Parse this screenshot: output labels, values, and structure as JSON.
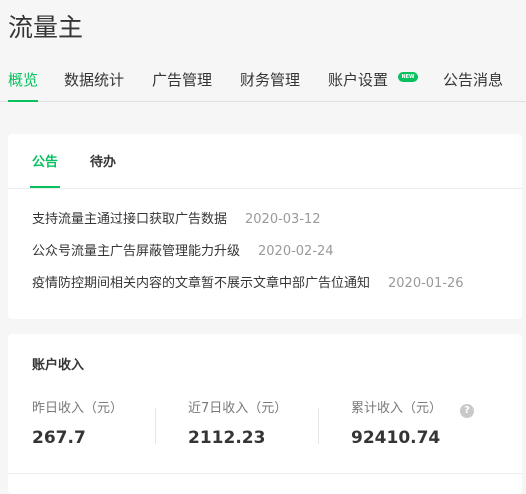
{
  "header": {
    "title": "流量主"
  },
  "nav": {
    "tabs": [
      {
        "label": "概览"
      },
      {
        "label": "数据统计"
      },
      {
        "label": "广告管理"
      },
      {
        "label": "财务管理"
      },
      {
        "label": "账户设置"
      },
      {
        "label": "公告消息"
      }
    ],
    "new_badge": "NEW"
  },
  "notice_card": {
    "tabs": [
      {
        "label": "公告"
      },
      {
        "label": "待办"
      }
    ],
    "items": [
      {
        "title": "支持流量主通过接口获取广告数据",
        "date": "2020-03-12"
      },
      {
        "title": "公众号流量主广告屏蔽管理能力升级",
        "date": "2020-02-24"
      },
      {
        "title": "疫情防控期间相关内容的文章暂不展示文章中部广告位通知",
        "date": "2020-01-26"
      }
    ]
  },
  "income_card": {
    "title": "账户收入",
    "stats": [
      {
        "label": "昨日收入（元）",
        "value": "267.7"
      },
      {
        "label": "近7日收入（元）",
        "value": "2112.23"
      },
      {
        "label": "累计收入（元）",
        "value": "92410.74"
      }
    ],
    "help_icon": "?"
  },
  "colors": {
    "accent": "#07c160",
    "text": "#353535",
    "muted": "#9a9a9a"
  }
}
